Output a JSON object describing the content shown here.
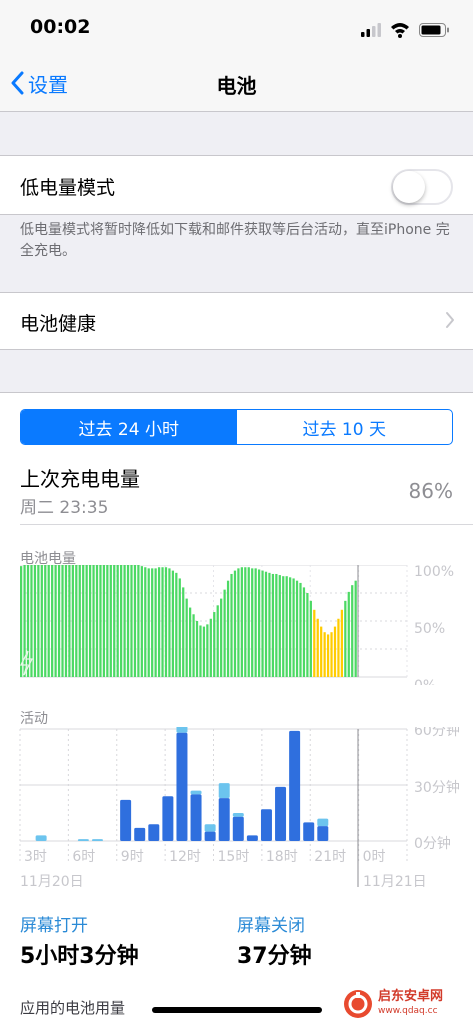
{
  "status_bar": {
    "time": "00:02"
  },
  "nav": {
    "back_label": "设置",
    "title": "电池"
  },
  "low_power": {
    "label": "低电量模式",
    "enabled": false,
    "footnote": "低电量模式将暂时降低如下载和邮件获取等后台活动，直至iPhone 完全充电。"
  },
  "battery_health": {
    "label": "电池健康"
  },
  "segments": {
    "items": [
      "过去 24 小时",
      "过去 10 天"
    ],
    "selected_index": 0
  },
  "last_charge": {
    "title": "上次充电电量",
    "time": "周二 23:35",
    "percent": "86%"
  },
  "battery_chart": {
    "label": "电池电量",
    "ticks": [
      "100%",
      "50%",
      "0%"
    ]
  },
  "activity_chart": {
    "label": "活动",
    "ticks": [
      "60分钟",
      "30分钟",
      "0分钟"
    ],
    "x_ticks": [
      "3时",
      "6时",
      "9时",
      "12时",
      "15时",
      "18时",
      "21时",
      "0时"
    ],
    "date_left": "11月20日",
    "date_right": "11月21日"
  },
  "stats": {
    "screen_on_label": "屏幕打开",
    "screen_on_value": "5小时3分钟",
    "screen_off_label": "屏幕关闭",
    "screen_off_value": "37分钟"
  },
  "app_usage": {
    "label": "应用的电池用量"
  },
  "watermark": {
    "text": "启东安卓网",
    "sub": "www.qdaq.cc"
  },
  "colors": {
    "accent": "#0a7aff",
    "battery_green": "#4cd964",
    "battery_low": "#ffcc00",
    "activity_on": "#2f6fde",
    "activity_off": "#6cc4ee"
  },
  "chart_data": [
    {
      "type": "bar",
      "title": "电池电量",
      "categories": [
        "0",
        "1",
        "2",
        "3",
        "4",
        "5",
        "6",
        "7",
        "8",
        "9",
        "10",
        "11",
        "12",
        "13",
        "14",
        "15",
        "16",
        "17",
        "18",
        "19",
        "20",
        "21",
        "22",
        "23",
        "24",
        "25",
        "26",
        "27",
        "28",
        "29",
        "30",
        "31",
        "32",
        "33",
        "34",
        "35",
        "36",
        "37",
        "38",
        "39",
        "40",
        "41",
        "42",
        "43",
        "44",
        "45",
        "46",
        "47",
        "48",
        "49",
        "50",
        "51",
        "52",
        "53",
        "54",
        "55",
        "56",
        "57",
        "58",
        "59",
        "60",
        "61",
        "62",
        "63",
        "64",
        "65",
        "66",
        "67",
        "68",
        "69",
        "70",
        "71",
        "72",
        "73",
        "74",
        "75",
        "76",
        "77",
        "78",
        "79",
        "80",
        "81",
        "82",
        "83",
        "84",
        "85",
        "86",
        "87",
        "88",
        "89",
        "90",
        "91",
        "92",
        "93",
        "94",
        "95",
        "96",
        "97"
      ],
      "values": [
        99,
        100,
        100,
        100,
        100,
        100,
        100,
        100,
        100,
        100,
        100,
        100,
        100,
        100,
        100,
        100,
        100,
        100,
        100,
        100,
        100,
        100,
        100,
        100,
        100,
        100,
        100,
        100,
        100,
        100,
        100,
        100,
        100,
        100,
        100,
        99,
        98,
        97,
        97,
        97,
        98,
        98,
        98,
        97,
        95,
        93,
        88,
        80,
        70,
        62,
        56,
        50,
        46,
        45,
        47,
        52,
        58,
        64,
        70,
        78,
        86,
        92,
        95,
        97,
        98,
        98,
        98,
        97,
        97,
        96,
        95,
        94,
        93,
        92,
        92,
        91,
        90,
        90,
        89,
        88,
        86,
        84,
        80,
        75,
        68,
        60,
        52,
        45,
        40,
        38,
        40,
        45,
        52,
        60,
        68,
        76,
        82,
        86
      ],
      "ylim": [
        0,
        100
      ],
      "ylabel": ""
    },
    {
      "type": "bar",
      "title": "活动",
      "categories": [
        "0",
        "1",
        "2",
        "3",
        "4",
        "5",
        "6",
        "7",
        "8",
        "9",
        "10",
        "11",
        "12",
        "13",
        "14",
        "15",
        "16",
        "17",
        "18",
        "19",
        "20",
        "21",
        "22",
        "23"
      ],
      "series": [
        {
          "name": "屏幕打开",
          "values": [
            0,
            0,
            0,
            0,
            0,
            0,
            0,
            22,
            7,
            9,
            24,
            58,
            25,
            5,
            23,
            13,
            3,
            17,
            29,
            59,
            10,
            8,
            0,
            0
          ]
        },
        {
          "name": "屏幕关闭",
          "values": [
            0,
            3,
            0,
            0,
            1,
            1,
            0,
            0,
            0,
            0,
            0,
            4,
            2,
            4,
            8,
            2,
            0,
            0,
            0,
            0,
            0,
            4,
            0,
            0
          ]
        }
      ],
      "ylim": [
        0,
        60
      ],
      "ylabel": ""
    }
  ]
}
